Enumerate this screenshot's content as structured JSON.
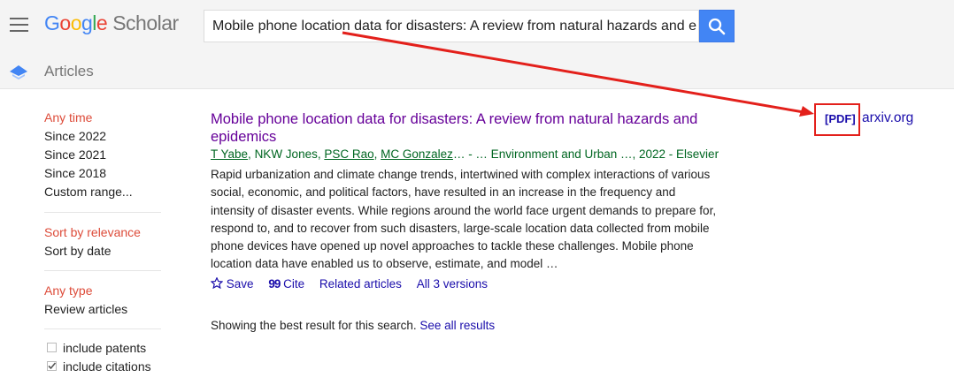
{
  "header": {
    "logo_google": [
      "G",
      "o",
      "o",
      "g",
      "l",
      "e"
    ],
    "logo_scholar": "Scholar",
    "search_value": "Mobile phone location data for disasters: A review from natural hazards and epidemics"
  },
  "bar2": {
    "label": "Articles"
  },
  "sidebar": {
    "time": {
      "heading": "Any time",
      "options": [
        "Since 2022",
        "Since 2021",
        "Since 2018",
        "Custom range..."
      ]
    },
    "sort": {
      "heading": "Sort by relevance",
      "option": "Sort by date"
    },
    "type": {
      "heading": "Any type",
      "option": "Review articles"
    },
    "checkboxes": [
      {
        "label": "include patents",
        "checked": false
      },
      {
        "label": "include citations",
        "checked": true
      }
    ]
  },
  "result": {
    "title_line1": "Mobile phone location data for disasters: A review from natural hazards and",
    "title_line2": "epidemics",
    "authors": [
      "T Yabe",
      "NKW Jones",
      "PSC Rao",
      "MC Gonzalez"
    ],
    "source": "… - … Environment and Urban …, 2022 - Elsevier",
    "snippet": "Rapid urbanization and climate change trends, intertwined with complex interactions of various social, economic, and political factors, have resulted in an increase in the frequency and intensity of disaster events. While regions around the world face urgent demands to prepare for, respond to, and to recover from such disasters, large-scale location data collected from mobile phone devices have opened up novel approaches to tackle these challenges. Mobile phone location data have enabled us to observe, estimate, and model …",
    "actions": {
      "save": "Save",
      "cite": "Cite",
      "related": "Related articles",
      "versions": "All 3 versions"
    },
    "pdf": {
      "tag": "[PDF]",
      "domain": "arxiv.org"
    }
  },
  "footer": {
    "text": "Showing the best result for this search.",
    "link": "See all results"
  },
  "colors": {
    "annotation": "#e3201b",
    "link": "#1a0dab",
    "visited": "#660099",
    "green": "#006621",
    "red_label": "#dd4b39"
  }
}
